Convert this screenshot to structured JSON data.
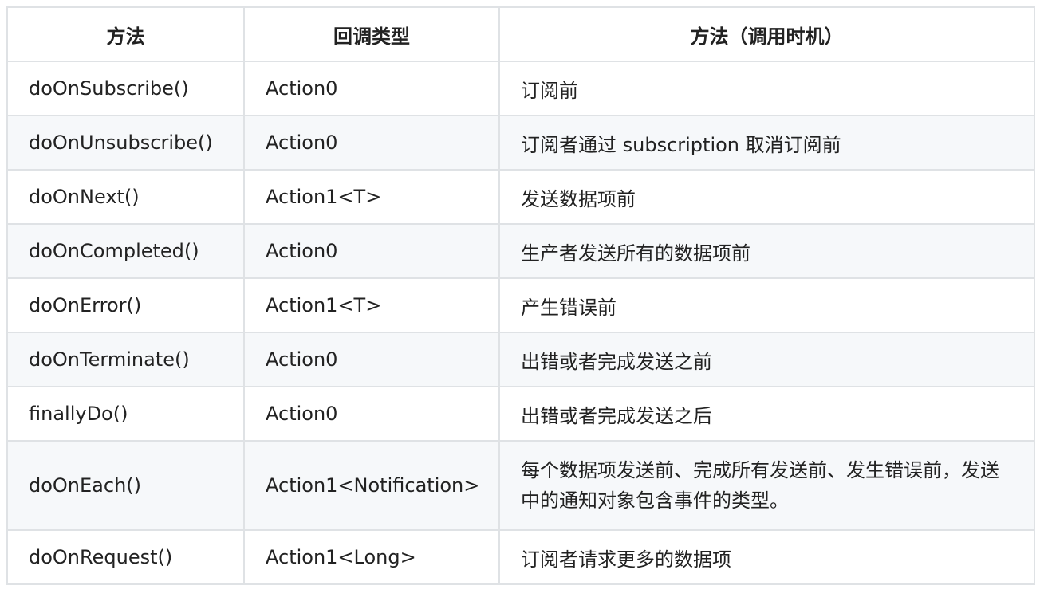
{
  "table": {
    "headers": [
      "方法",
      "回调类型",
      "方法（调用时机）"
    ],
    "rows": [
      [
        "doOnSubscribe()",
        "Action0",
        "订阅前"
      ],
      [
        "doOnUnsubscribe()",
        "Action0",
        "订阅者通过 subscription 取消订阅前"
      ],
      [
        "doOnNext()",
        "Action1<T>",
        "发送数据项前"
      ],
      [
        "doOnCompleted()",
        "Action0",
        "生产者发送所有的数据项前"
      ],
      [
        "doOnError()",
        "Action1<T>",
        "产生错误前"
      ],
      [
        "doOnTerminate()",
        "Action0",
        "出错或者完成发送之前"
      ],
      [
        "finallyDo()",
        "Action0",
        "出错或者完成发送之后"
      ],
      [
        "doOnEach()",
        "Action1<Notification>",
        "每个数据项发送前、完成所有发送前、发生错误前，发送中的通知对象包含事件的类型。"
      ],
      [
        "doOnRequest()",
        "Action1<Long>",
        "订阅者请求更多的数据项"
      ]
    ]
  },
  "colors": {
    "border": "#dfe2e5",
    "stripe": "#f6f8fa",
    "text": "#222222"
  }
}
